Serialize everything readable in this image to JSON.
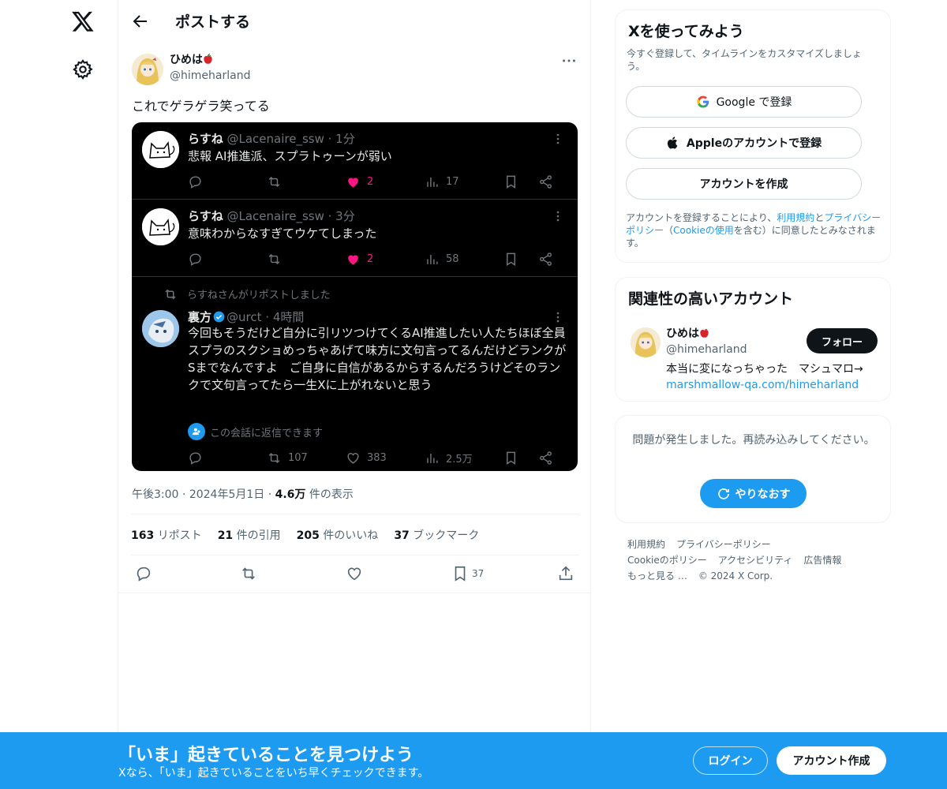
{
  "header": {
    "title": "ポストする"
  },
  "post": {
    "author_name": "ひめは",
    "author_handle": "@himeharland",
    "text": "これでゲラゲラ笑ってる",
    "time": "午後3:00",
    "date": "2024年5月1日",
    "views": "4.6万",
    "views_suffix": "件の表示",
    "stats": {
      "reposts": "163",
      "reposts_label": "リポスト",
      "quotes": "21",
      "quotes_label": "件の引用",
      "likes": "205",
      "likes_label": "件のいいね",
      "bookmarks": "37",
      "bookmarks_label": "ブックマーク"
    },
    "bookmark_count": "37"
  },
  "screenshot": {
    "tweet1": {
      "name": "らすね",
      "handle": "@Lacenaire_ssw",
      "time": "1分",
      "text": "悲報 AI推進派、スプラトゥーンが弱い",
      "likes": "2",
      "views": "17"
    },
    "tweet2": {
      "name": "らすね",
      "handle": "@Lacenaire_ssw",
      "time": "3分",
      "text": "意味わからなすぎてウケてしまった",
      "likes": "2",
      "views": "58"
    },
    "retweet_note": "らすねさんがリポストしました",
    "tweet3": {
      "name": "裏方",
      "handle": "@urct",
      "time": "4時間",
      "text": "今回もそうだけど自分に引リツつけてくるAI推進したい人たちほぼ全員スプラのスクショめっちゃあげて味方に文句言ってるんだけどランクがSまでなんですよ　ご自身に自信があるからするんだろうけどそのランクで文句言ってたら一生Xに上がれないと思う",
      "reply_note": "この会話に返信できます",
      "retweets": "107",
      "likes": "383",
      "views": "2.5万"
    }
  },
  "signup_card": {
    "title": "Xを使ってみよう",
    "subtitle": "今すぐ登録して、タイムラインをカスタマイズしましょう。",
    "google": "Google で登録",
    "apple": "Appleのアカウントで登録",
    "create": "アカウントを作成",
    "legal_1": "アカウントを登録することにより、",
    "terms": "利用規約",
    "legal_2": "と",
    "privacy": "プライバシーポリシー",
    "legal_3": "（",
    "cookie": "Cookieの使用",
    "legal_4": "を含む）に同意したとみなされます。"
  },
  "related": {
    "title": "関連性の高いアカウント",
    "name": "ひめは",
    "handle": "@himeharland",
    "follow": "フォロー",
    "bio": "本当に変になっちゃった　マシュマロ→ ",
    "bio_link": "marshmallow-qa.com/himeharland"
  },
  "error_card": {
    "message": "問題が発生しました。再読み込みしてください。",
    "retry": "やりなおす"
  },
  "footer": {
    "links": [
      "利用規約",
      "プライバシーポリシー",
      "Cookieのポリシー",
      "アクセシビリティ",
      "広告情報",
      "もっと見る …",
      "© 2024 X Corp."
    ]
  },
  "banner": {
    "title": "「いま」起きていることを見つけよう",
    "subtitle": "Xなら、「いま」起きていることをいち早くチェックできます。",
    "login": "ログイン",
    "signup": "アカウント作成"
  },
  "colors": {
    "accent": "#1d9bf0",
    "like": "#f91880",
    "text": "#0f1419",
    "muted": "#536471"
  }
}
